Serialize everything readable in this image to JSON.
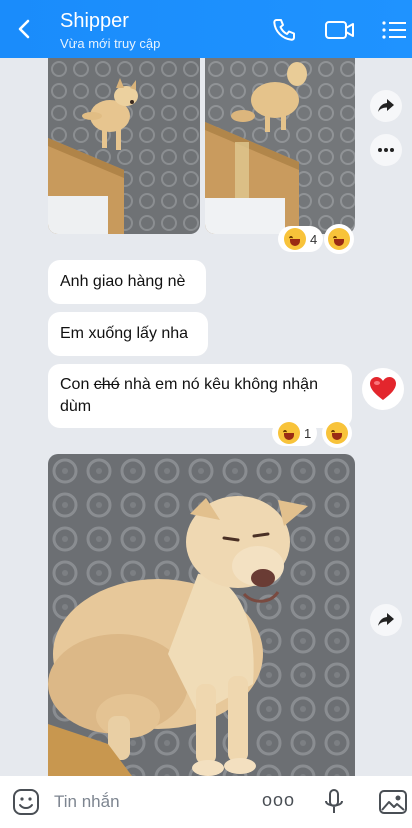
{
  "header": {
    "title": "Shipper",
    "subtitle": "Vừa mới truy cập"
  },
  "messages": {
    "msg1": "Anh giao hàng nè",
    "msg2": "Em xuống lấy nha",
    "msg3_prefix": "Con ",
    "msg3_strike": "chó",
    "msg3_rest": " nhà em nó kêu không nhận dùm"
  },
  "reactions": {
    "photos_count": "4",
    "msg3_count": "1"
  },
  "composer": {
    "placeholder": "Tin nhắn",
    "more_label": "ooo"
  },
  "colors": {
    "header_blue": "#1a8cfb",
    "chat_bg": "#e6e9ee"
  }
}
